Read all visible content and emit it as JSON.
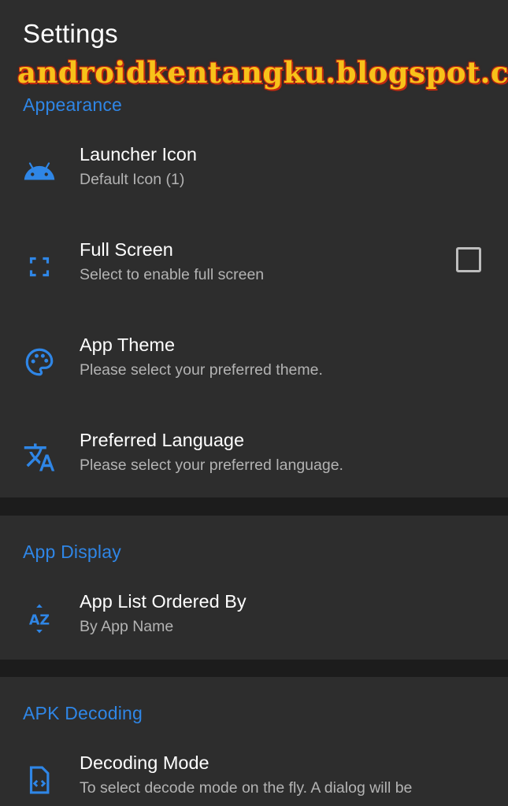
{
  "header": {
    "title": "Settings",
    "watermark": "androidkentangku.blogspot.com"
  },
  "colors": {
    "accent": "#2f86e6",
    "card_bg": "#2d2d2d",
    "page_bg": "#1c1c1c",
    "title_text": "#ffffff",
    "summary_text": "#b3b3b3"
  },
  "sections": {
    "appearance": {
      "header": "Appearance",
      "items": [
        {
          "title": "Launcher Icon",
          "summary": "Default Icon (1)",
          "icon": "android-icon"
        },
        {
          "title": "Full Screen",
          "summary": "Select to enable full screen",
          "icon": "fullscreen-icon",
          "checked": false
        },
        {
          "title": "App Theme",
          "summary": "Please select your preferred theme.",
          "icon": "palette-icon"
        },
        {
          "title": "Preferred Language",
          "summary": "Please select your preferred language.",
          "icon": "translate-icon"
        }
      ]
    },
    "app_display": {
      "header": "App Display",
      "items": [
        {
          "title": "App List Ordered By",
          "summary": "By App Name",
          "icon": "sort-az-icon"
        }
      ]
    },
    "apk_decoding": {
      "header": "APK Decoding",
      "items": [
        {
          "title": "Decoding Mode",
          "summary": "To select decode mode on the fly. A dialog will be",
          "icon": "code-file-icon"
        }
      ]
    }
  }
}
